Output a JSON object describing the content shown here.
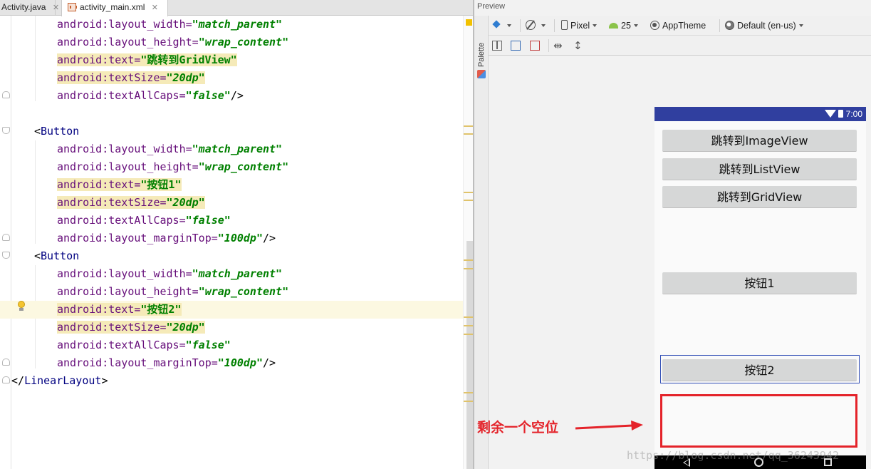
{
  "tabs": [
    {
      "label": "Activity.java"
    },
    {
      "label": "activity_main.xml"
    }
  ],
  "code": {
    "l1": {
      "attr": "android:layout_width=",
      "value": "\"match_parent\""
    },
    "l2": {
      "attr": "android:layout_height=",
      "value": "\"wrap_content\""
    },
    "l3": {
      "attr": "android:text=",
      "value": "\"跳转到GridView\""
    },
    "l4": {
      "attr": "android:textSize=",
      "value": "\"20dp\""
    },
    "l5": {
      "attr": "android:textAllCaps=",
      "value": "\"false\"",
      "close": "/>"
    },
    "l7": {
      "open": "<",
      "tag": "Button"
    },
    "l8": {
      "attr": "android:layout_width=",
      "value": "\"match_parent\""
    },
    "l9": {
      "attr": "android:layout_height=",
      "value": "\"wrap_content\""
    },
    "l10": {
      "attr": "android:text=",
      "value": "\"按钮1\""
    },
    "l11": {
      "attr": "android:textSize=",
      "value": "\"20dp\""
    },
    "l12": {
      "attr": "android:textAllCaps=",
      "value": "\"false\""
    },
    "l13": {
      "attr": "android:layout_marginTop=",
      "value": "\"100dp\"",
      "close": "/>"
    },
    "l14": {
      "open": "<",
      "tag": "Button"
    },
    "l15": {
      "attr": "android:layout_width=",
      "value": "\"match_parent\""
    },
    "l16": {
      "attr": "android:layout_height=",
      "value": "\"wrap_content\""
    },
    "l17": {
      "attr": "android:text=",
      "value_a": "\"按钮2",
      "value_b": "\""
    },
    "l18": {
      "attr": "android:textSize=",
      "value": "\"20dp\""
    },
    "l19": {
      "attr": "android:textAllCaps=",
      "value": "\"false\""
    },
    "l20": {
      "attr": "android:layout_marginTop=",
      "value": "\"100dp\"",
      "close": "/>"
    },
    "l21": {
      "open": "</",
      "tag": "LinearLayout",
      "close": ">"
    }
  },
  "preview": {
    "title": "Preview",
    "palette_label": "Palette",
    "toolbar": {
      "device": "Pixel",
      "api": "25",
      "theme": "AppTheme",
      "locale": "Default (en-us)"
    }
  },
  "device": {
    "time": "7:00",
    "buttons": {
      "image": "跳转到ImageView",
      "list": "跳转到ListView",
      "grid": "跳转到GridView",
      "b1": "按钮1",
      "b2": "按钮2"
    }
  },
  "annotation": {
    "label": "剩余一个空位",
    "color": "#e4232a"
  },
  "watermark": "https://blog.csdn.net/qq_36243942",
  "colors": {
    "status_bar": "#303f9f",
    "button_bg": "#d6d7d7",
    "attr": "#660e7a",
    "value": "#008000",
    "tag": "#000080"
  }
}
